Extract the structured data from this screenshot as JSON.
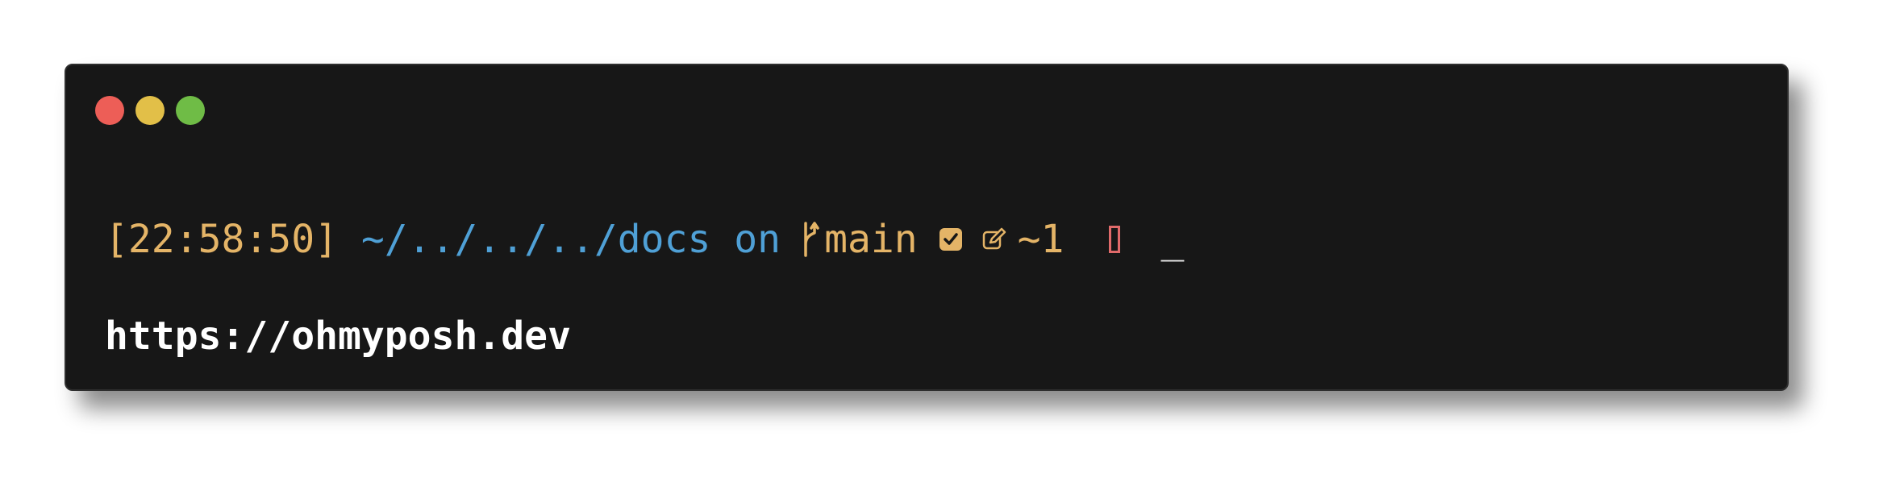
{
  "window": {
    "buttons": [
      {
        "name": "close",
        "color": "#ed5e57"
      },
      {
        "name": "minimize",
        "color": "#e2bf48"
      },
      {
        "name": "maximize",
        "color": "#6fbc46"
      }
    ]
  },
  "prompt": {
    "time": "[22:58:50]",
    "path_prefix": " ~/../../../",
    "path_dir": "docs",
    "on": " on",
    "branch_icon": "git-branch-icon",
    "branch": "main",
    "status_icon": "check-square-icon",
    "edit_icon": "edit-icon",
    "changes": "~1",
    "cursor": "_"
  },
  "output": {
    "url": "https://ohmyposh.dev"
  },
  "colors": {
    "background": "#171717",
    "time": "#e4b467",
    "path": "#4fa0d6",
    "branch": "#e4b467",
    "error": "#e06a6a",
    "url": "#ffffff"
  }
}
